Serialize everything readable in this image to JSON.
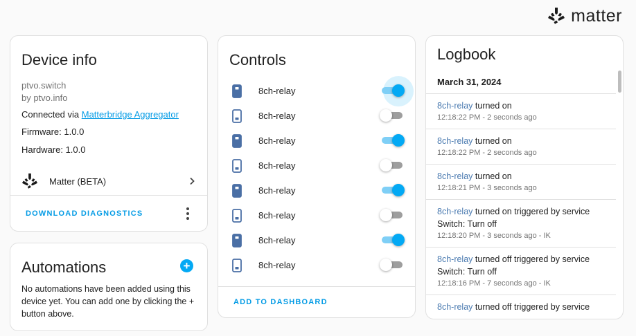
{
  "brand": {
    "name": "matter",
    "logo_icon": "matter-logo-icon"
  },
  "device_info": {
    "title": "Device info",
    "model": "ptvo.switch",
    "manufacturer": "by ptvo.info",
    "connected_via_prefix": "Connected via ",
    "connected_via_link": "Matterbridge Aggregator",
    "firmware": "Firmware: 1.0.0",
    "hardware": "Hardware: 1.0.0",
    "integration_label": "Matter (BETA)",
    "download_label": "DOWNLOAD DIAGNOSTICS"
  },
  "automations": {
    "title": "Automations",
    "add_label": "+",
    "empty_text": "No automations have been added using this device yet. You can add one by clicking the + button above."
  },
  "controls": {
    "title": "Controls",
    "items": [
      {
        "name": "8ch-relay",
        "on": true,
        "focused": true
      },
      {
        "name": "8ch-relay",
        "on": false
      },
      {
        "name": "8ch-relay",
        "on": true
      },
      {
        "name": "8ch-relay",
        "on": false
      },
      {
        "name": "8ch-relay",
        "on": true
      },
      {
        "name": "8ch-relay",
        "on": false
      },
      {
        "name": "8ch-relay",
        "on": true
      },
      {
        "name": "8ch-relay",
        "on": false
      }
    ],
    "add_dashboard_label": "ADD TO DASHBOARD",
    "accent": "#03a9f4"
  },
  "logbook": {
    "title": "Logbook",
    "date": "March 31, 2024",
    "entries": [
      {
        "entity": "8ch-relay",
        "message": " turned on",
        "time": "12:18:22 PM - 2 seconds ago"
      },
      {
        "entity": "8ch-relay",
        "message": " turned on",
        "time": "12:18:22 PM - 2 seconds ago"
      },
      {
        "entity": "8ch-relay",
        "message": " turned on",
        "time": "12:18:21 PM - 3 seconds ago"
      },
      {
        "entity": "8ch-relay",
        "message": " turned on triggered by service Switch: Turn off",
        "time": "12:18:20 PM - 3 seconds ago - IK"
      },
      {
        "entity": "8ch-relay",
        "message": " turned off triggered by service Switch: Turn off",
        "time": "12:18:16 PM - 7 seconds ago - IK"
      },
      {
        "entity": "8ch-relay",
        "message": " turned off triggered by service",
        "time": ""
      }
    ]
  }
}
